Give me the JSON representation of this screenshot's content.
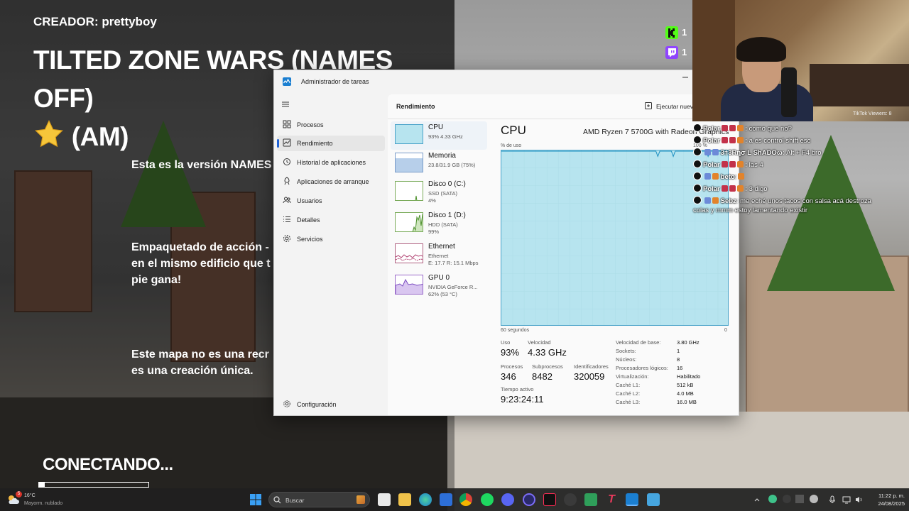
{
  "game": {
    "creator": "CREADOR: prettyboy",
    "title_line1": "TILTED ZONE WARS (NAMES OFF)",
    "title_line2": "(AM)",
    "paragraph1": "Esta es la versión NAMES",
    "paragraph2_line1": "Empaquetado de acción -",
    "paragraph2_line2": "en el mismo edificio que t",
    "paragraph2_line3": "pie gana!",
    "paragraph3_line1": "Este mapa no es una recr",
    "paragraph3_line2": "es una creación única.",
    "status": "CONECTANDO...",
    "progress": 0.05
  },
  "badges": [
    {
      "icon": "kick-icon",
      "count": "1",
      "color": "#53fc18"
    },
    {
      "icon": "twitch-icon",
      "count": "1",
      "color": "#9146ff"
    }
  ],
  "task_manager": {
    "title": "Administrador de tareas",
    "page_title": "Rendimiento",
    "run_task_label": "Ejecutar nueva",
    "nav": [
      {
        "label": "Procesos",
        "icon": "processes-icon"
      },
      {
        "label": "Rendimiento",
        "icon": "performance-icon"
      },
      {
        "label": "Historial de aplicaciones",
        "icon": "history-icon"
      },
      {
        "label": "Aplicaciones de arranque",
        "icon": "startup-icon"
      },
      {
        "label": "Usuarios",
        "icon": "users-icon"
      },
      {
        "label": "Detalles",
        "icon": "details-icon"
      },
      {
        "label": "Servicios",
        "icon": "services-icon"
      }
    ],
    "settings_label": "Configuración",
    "perf_items": [
      {
        "name": "CPU",
        "sub1": "93% 4.33 GHz",
        "sub2": "",
        "sub3": ""
      },
      {
        "name": "Memoria",
        "sub1": "23.8/31.9 GB (75%)",
        "sub2": "",
        "sub3": ""
      },
      {
        "name": "Disco 0 (C:)",
        "sub1": "SSD (SATA)",
        "sub2": "4%",
        "sub3": ""
      },
      {
        "name": "Disco 1 (D:)",
        "sub1": "HDD (SATA)",
        "sub2": "99%",
        "sub3": ""
      },
      {
        "name": "Ethernet",
        "sub1": "Ethernet",
        "sub2": "E: 17.7 R: 15.1 Mbps",
        "sub3": ""
      },
      {
        "name": "GPU 0",
        "sub1": "NVIDIA GeForce R...",
        "sub2": "62% (53 °C)",
        "sub3": ""
      }
    ],
    "cpu": {
      "heading": "CPU",
      "model": "AMD Ryzen 7 5700G with Radeon Graphics",
      "graph_label": "% de uso",
      "graph_max": "100 %",
      "graph_time": "60 segundos",
      "graph_min": "0",
      "usage_history": [
        100,
        100,
        100,
        100,
        100,
        100,
        100,
        100,
        100,
        100,
        100,
        100,
        100,
        100,
        100,
        100,
        100,
        100,
        100,
        100,
        100,
        100,
        100,
        100,
        100,
        100,
        100,
        100,
        100,
        100,
        100,
        100,
        100,
        100,
        100,
        100,
        100,
        100,
        100,
        100,
        100,
        100,
        100,
        100,
        100,
        100,
        100,
        100,
        100,
        100,
        100,
        100,
        100,
        100,
        100,
        100,
        100,
        100,
        100,
        100,
        100,
        100,
        100,
        100,
        100,
        100,
        100,
        100,
        100,
        100,
        100,
        100,
        100,
        100,
        100,
        100,
        100,
        100,
        100,
        100,
        100,
        97,
        100,
        100,
        100,
        100,
        100,
        100,
        100,
        97,
        100,
        100,
        100,
        100,
        100,
        100,
        100,
        100,
        100,
        100,
        100,
        100,
        100,
        100,
        100,
        100,
        100,
        97,
        100,
        100,
        100,
        100,
        100,
        100,
        100,
        100,
        100,
        100,
        100
      ],
      "usage_label": "Uso",
      "usage": "93%",
      "speed_label": "Velocidad",
      "speed": "4.33 GHz",
      "processes_label": "Procesos",
      "processes": "346",
      "threads_label": "Subprocesos",
      "threads": "8482",
      "handles_label": "Identificadores",
      "handles": "320059",
      "uptime_label": "Tiempo activo",
      "uptime": "9:23:24:11",
      "specs": [
        {
          "key": "Velocidad de base:",
          "value": "3.80 GHz"
        },
        {
          "key": "Sockets:",
          "value": "1"
        },
        {
          "key": "Núcleos:",
          "value": "8"
        },
        {
          "key": "Procesadores lógicos:",
          "value": "16"
        },
        {
          "key": "Virtualización:",
          "value": "Habilitado"
        },
        {
          "key": "Caché L1:",
          "value": "512 kB"
        },
        {
          "key": "Caché L2:",
          "value": "4.0 MB"
        },
        {
          "key": "Caché L3:",
          "value": "16.0 MB"
        }
      ]
    }
  },
  "webcam": {
    "viewers": "TikTok Viewers: 8"
  },
  "chat": [
    {
      "user": "Polar",
      "message": ": como que no?"
    },
    {
      "user": "Polar",
      "message": ": a es control shift esc"
    },
    {
      "user": "3†3Rησ L ShADOω",
      "message": ": Alt + F4 bro"
    },
    {
      "user": "Polar",
      "message": ": las 4"
    },
    {
      "user": "beto",
      "message": ":"
    },
    {
      "user": "Polar",
      "message": ": 3 digo"
    },
    {
      "user": "Sebz",
      "message": ": me eché unos tacos con salsa acá destroza"
    },
    {
      "user": "",
      "message": "colas y mmm estoy lamentando existir"
    }
  ],
  "taskbar": {
    "weather_temp": "16°C",
    "weather_cond": "Mayorm. nublado",
    "weather_badge": "5",
    "search_placeholder": "Buscar",
    "clock_time": "11:22 p. m.",
    "clock_date": "24/08/2025"
  }
}
